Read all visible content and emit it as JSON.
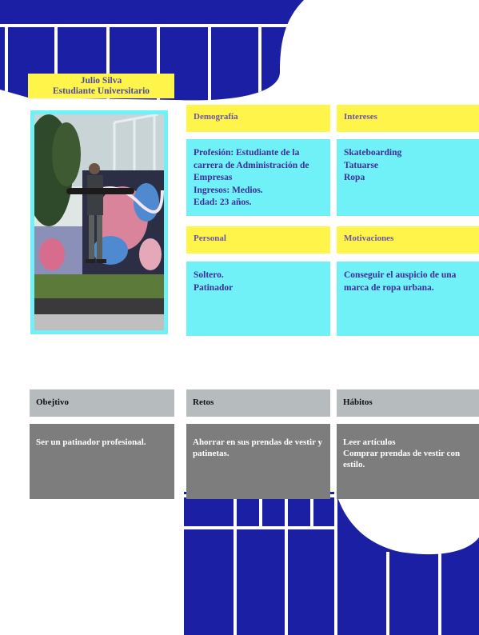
{
  "profile": {
    "name": "Julio Silva",
    "role": "Estudiante Universitario"
  },
  "sections": {
    "demografia": {
      "title": "Demografía",
      "lines": [
        "Profesión:  Estudiante de la carrera de Administración de Empresas",
        "Ingresos: Medios.",
        "Edad: 23 años."
      ]
    },
    "intereses": {
      "title": "Intereses",
      "lines": [
        "Skateboarding",
        "Tatuarse",
        "Ropa"
      ]
    },
    "personal": {
      "title": "Personal",
      "lines": [
        "Soltero.",
        "Patinador"
      ]
    },
    "motivaciones": {
      "title": "Motivaciones",
      "lines": [
        "Conseguir el auspicio de una marca de ropa urbana."
      ]
    },
    "objetivo": {
      "title": "Obejtivo",
      "lines": [
        "Ser un patinador profesional."
      ]
    },
    "retos": {
      "title": "Retos",
      "lines": [
        "Ahorrar en sus prendas de vestir y patinetas."
      ]
    },
    "habitos": {
      "title": "Hábitos",
      "lines": [
        "Leer artículos",
        "Comprar prendas de vestir con estilo."
      ]
    }
  },
  "colors": {
    "navy": "#1a1fa3",
    "yellow": "#fff44a",
    "cyan": "#6ff1f7",
    "gray_header": "#b6bcbe",
    "gray_box": "#7d7d7d"
  }
}
